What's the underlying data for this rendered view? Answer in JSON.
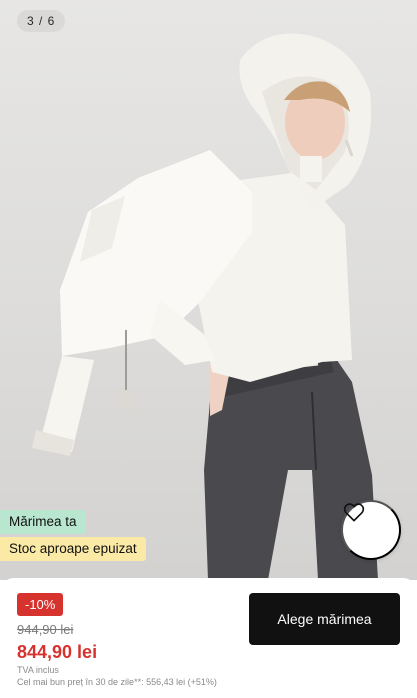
{
  "gallery": {
    "counter": "3 / 6"
  },
  "product_badges": {
    "size_badge": "Mărimea ta",
    "stock_badge": "Stoc aproape epuizat"
  },
  "favorite": {
    "icon": "heart-icon"
  },
  "pricing": {
    "discount": "-10%",
    "old_price": "944,90 lei",
    "price": "844,90 lei",
    "vat_note": "TVA inclus",
    "lowest_price_note": "Cel mai bun preț în 30 de zile**: 556,43 lei (+51%)"
  },
  "cta": {
    "choose_size_label": "Alege mărimea"
  },
  "colors": {
    "sale_red": "#d6332f",
    "size_badge_bg": "#b8e6cf",
    "stock_badge_bg": "#fbe9a6",
    "cta_bg": "#111111"
  }
}
